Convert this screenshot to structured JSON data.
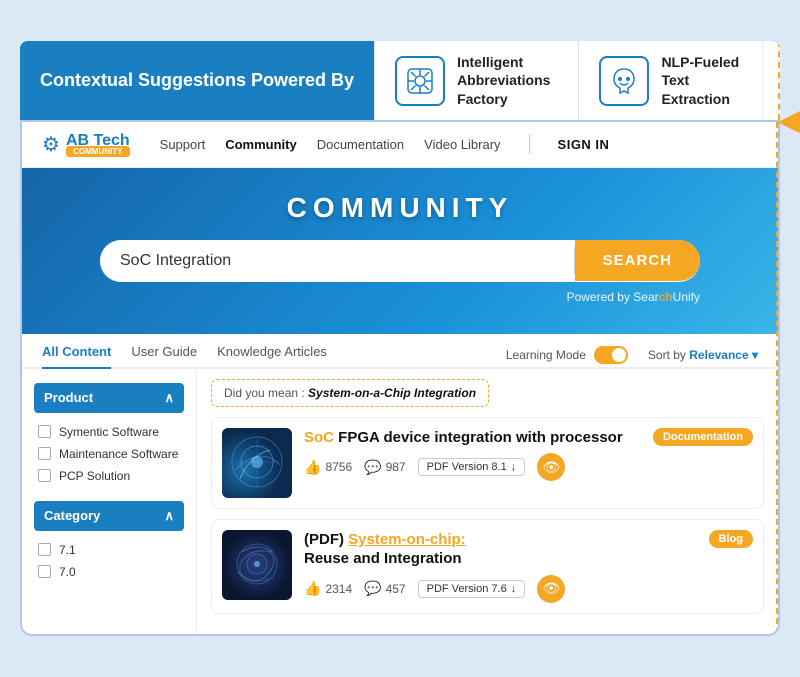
{
  "banner": {
    "left_text": "Contextual Suggestions Powered By",
    "feature1": {
      "icon": "🔷",
      "title": "Intelligent Abbreviations Factory"
    },
    "feature2": {
      "icon": "🤲",
      "title": "NLP-Fueled Text Extraction"
    }
  },
  "navbar": {
    "logo_text": "AB Tech",
    "logo_badge": "COMMUNITY",
    "links": [
      "Support",
      "Community",
      "Documentation",
      "Video Library"
    ],
    "active_link": "Community",
    "signin": "SIGN IN"
  },
  "hero": {
    "title": "COMMUNITY",
    "search_placeholder": "SoC Integration",
    "search_button": "SEARCH",
    "powered_by": "Powered by SearchUnify"
  },
  "tabs": {
    "items": [
      "All Content",
      "User Guide",
      "Knowledge Articles"
    ],
    "active": "All Content",
    "learning_mode_label": "Learning Mode",
    "sort_label": "Sort by",
    "sort_value": "Relevance"
  },
  "filters": {
    "groups": [
      {
        "label": "Product",
        "items": [
          "Symentic Software",
          "Maintenance Software",
          "PCP Solution"
        ]
      },
      {
        "label": "Category",
        "items": [
          "7.1",
          "7.0"
        ]
      }
    ]
  },
  "results": {
    "did_you_mean_prefix": "Did you mean : ",
    "did_you_mean_term": "System-on-a-Chip Integration",
    "items": [
      {
        "title_prefix": "",
        "highlight": "SoC",
        "title_suffix": " FPGA device integration with processor",
        "badge": "Documentation",
        "likes": "8756",
        "comments": "987",
        "pdf_label": "PDF Version 8.1"
      },
      {
        "title_prefix": "(PDF) ",
        "highlight": "System-on-chip:",
        "title_suffix": "\nReuse and Integration",
        "badge": "Blog",
        "likes": "2314",
        "comments": "457",
        "pdf_label": "PDF Version 7.6"
      }
    ]
  }
}
